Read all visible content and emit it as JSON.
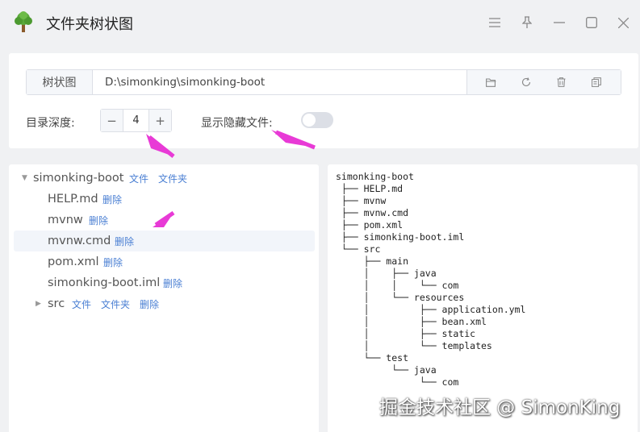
{
  "app": {
    "title": "文件夹树状图",
    "logo_icon": "tree-icon",
    "window_controls": [
      "menu-icon",
      "pin-icon",
      "minimize-icon",
      "maximize-icon",
      "close-icon"
    ]
  },
  "path_bar": {
    "tab_label": "树状图",
    "path": "D:\\simonking\\simonking-boot",
    "actions": [
      "folder-open-icon",
      "refresh-icon",
      "delete-icon",
      "copy-icon"
    ]
  },
  "options": {
    "depth_label": "目录深度:",
    "depth_value": "4",
    "minus": "−",
    "plus": "+",
    "hidden_label": "显示隐藏文件:",
    "hidden_enabled": false
  },
  "tree": {
    "root": {
      "name": "simonking-boot",
      "actions": [
        "文件",
        "文件夹"
      ]
    },
    "items": [
      {
        "name": "HELP.md",
        "actions": [
          "删除"
        ]
      },
      {
        "name": "mvnw",
        "actions": [
          "删除"
        ]
      },
      {
        "name": "mvnw.cmd",
        "actions": [
          "删除"
        ]
      },
      {
        "name": "pom.xml",
        "actions": [
          "删除"
        ]
      },
      {
        "name": "simonking-boot.iml",
        "actions": [
          "删除"
        ]
      },
      {
        "name": "src",
        "actions": [
          "文件",
          "文件夹",
          "删除"
        ]
      }
    ]
  },
  "tree_text": "simonking-boot\n ├── HELP.md\n ├── mvnw\n ├── mvnw.cmd\n ├── pom.xml\n ├── simonking-boot.iml\n └── src\n     ├── main\n     │    ├── java\n     │    │    └── com\n     │    └── resources\n     │         ├── application.yml\n     │         ├── bean.xml\n     │         ├── static\n     │         └── templates\n     └── test\n          └── java\n               └── com",
  "watermark": "掘金技术社区 @ SimonKing",
  "colors": {
    "accent": "#4a7fd3",
    "annotation_arrow": "#e83ad6"
  }
}
